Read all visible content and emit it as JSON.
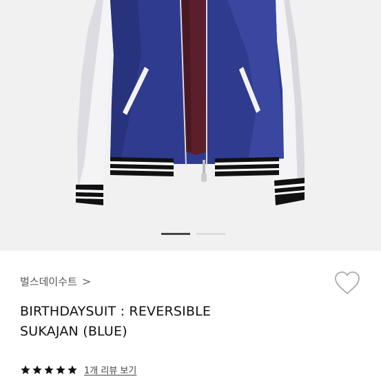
{
  "product": {
    "image_icon": "jacket-photo",
    "carousel": {
      "total": 2,
      "current": 1
    },
    "brand": "벌스데이수트",
    "brand_arrow": ">",
    "title_lines": [
      "BIRTHDAYSUIT : REVERSIBLE",
      "SUKAJAN (BLUE)"
    ],
    "wishlist_icon": "heart-outline-icon",
    "rating": {
      "stars": 5,
      "max": 5
    },
    "review_link": "1개 리뷰 보기"
  },
  "colors": {
    "accent_dark": "#111111",
    "jacket_blue": "#2f3b8e",
    "lining_burgundy": "#5a1f2a"
  }
}
